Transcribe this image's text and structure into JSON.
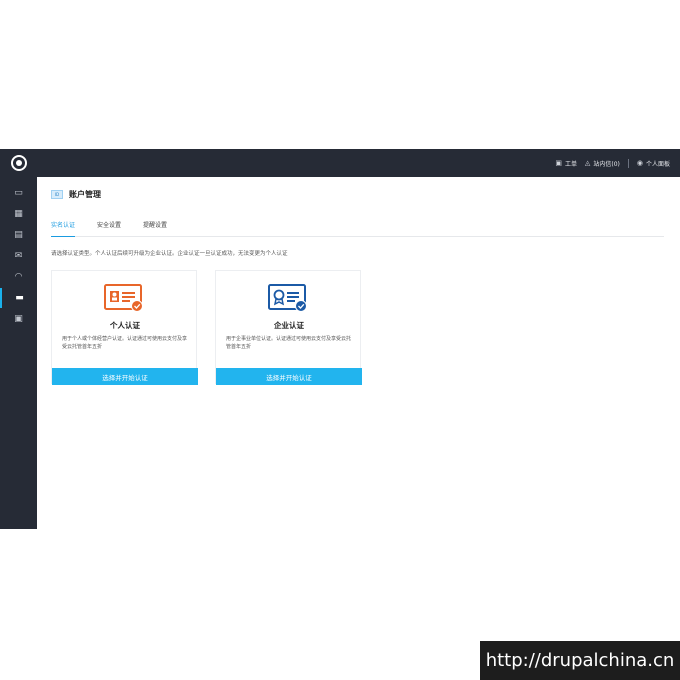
{
  "topbar": {
    "items": [
      {
        "icon": "ticket-icon",
        "glyph": "▣",
        "label": "工单"
      },
      {
        "icon": "bell-icon",
        "glyph": "◬",
        "label": "站内信(0)"
      },
      {
        "icon": "user-icon",
        "glyph": "◉",
        "label": "个人面板"
      }
    ]
  },
  "sidebar": {
    "items": [
      {
        "icon": "monitor-icon",
        "glyph": "▭"
      },
      {
        "icon": "grid-icon",
        "glyph": "▦"
      },
      {
        "icon": "save-icon",
        "glyph": "▤"
      },
      {
        "icon": "mail-icon",
        "glyph": "✉"
      },
      {
        "icon": "gauge-icon",
        "glyph": "◠"
      },
      {
        "icon": "id-card-icon",
        "glyph": "▬",
        "active": true
      },
      {
        "icon": "package-icon",
        "glyph": "▣"
      }
    ]
  },
  "page": {
    "title": "账户管理",
    "badge": "ID",
    "tabs": [
      {
        "label": "实名认证",
        "active": true
      },
      {
        "label": "安全设置",
        "active": false
      },
      {
        "label": "提醒设置",
        "active": false
      }
    ],
    "notice": "请选择认证类型。个人认证后续可升级为企业认证。企业认证一旦认证成功，无法变更为个人认证"
  },
  "cards": [
    {
      "name": "个人认证",
      "desc": "用于个人或个体经营户认证。认证通过可使用云支付及享受云托管首年五折",
      "button": "选择并开始认证",
      "color": "#e8662a"
    },
    {
      "name": "企业认证",
      "desc": "用于企事业单位认证。认证通过可使用云支付及享受云托管首年五折",
      "button": "选择并开始认证",
      "color": "#1b5aa6"
    }
  ],
  "watermark": "http://drupalchina.cn",
  "colors": {
    "dark": "#262b36",
    "accent": "#22b4ee"
  }
}
